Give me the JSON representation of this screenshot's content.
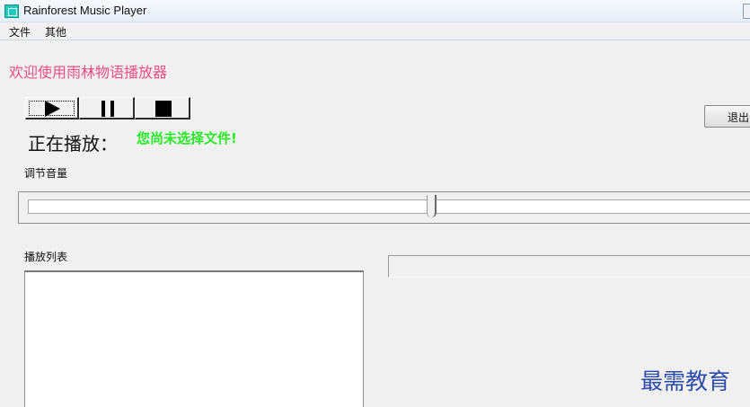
{
  "window": {
    "title": "Rainforest Music Player",
    "app_icon": "music-player-icon"
  },
  "menu": {
    "items": [
      {
        "label": "文件"
      },
      {
        "label": "其他"
      }
    ]
  },
  "main": {
    "welcome_text": "欢迎使用雨林物语播放器",
    "controls": {
      "play_icon": "play-icon",
      "pause_icon": "pause-icon",
      "stop_icon": "stop-icon"
    },
    "exit_label": "退出",
    "playing_label": "正在播放：",
    "playing_status": "您尚未选择文件!",
    "volume_label": "调节音量",
    "volume_level": 0.51,
    "playlist_label": "播放列表",
    "playlist_items": [],
    "watermark": "最需教育"
  },
  "colors": {
    "welcome": "#ef4d83",
    "status": "#28ea28",
    "watermark": "#2c4baa"
  }
}
